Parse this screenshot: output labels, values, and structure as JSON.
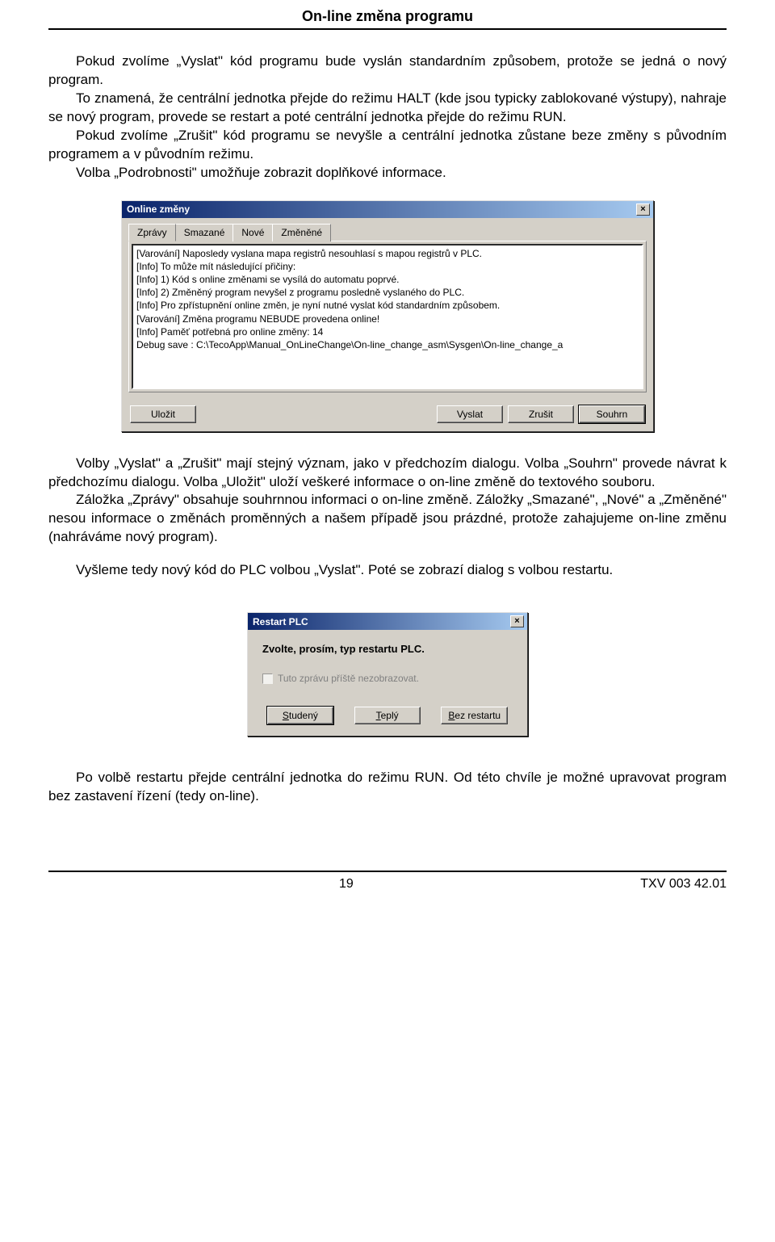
{
  "header": {
    "title": "On-line změna programu"
  },
  "para1": "Pokud zvolíme „Vyslat\" kód programu bude vyslán standardním způsobem, protože se jedná o nový program.",
  "para2": "To znamená, že centrální jednotka přejde do režimu HALT (kde jsou typicky zablokované výstupy), nahraje se nový program, provede se restart a poté centrální jednotka přejde do režimu RUN.",
  "para3": "Pokud zvolíme „Zrušit\" kód programu se nevyšle a centrální jednotka zůstane beze změny s původním programem a v původním režimu.",
  "para4": "Volba „Podrobnosti\" umožňuje zobrazit doplňkové informace.",
  "dialog1": {
    "title": "Online změny",
    "tabs": [
      "Zprávy",
      "Smazané",
      "Nové",
      "Změněné"
    ],
    "messages": [
      "[Varování] Naposledy vyslana mapa registrů nesouhlasí s mapou registrů v PLC.",
      "[Info] To může mít následující přičiny:",
      "[Info] 1) Kód s online změnami se vysílá do automatu poprvé.",
      "[Info] 2) Změněný program nevyšel z programu posledně vyslaného do PLC.",
      "[Info] Pro zpřístupnění online změn, je nyní nutné vyslat kód standardním způsobem.",
      "[Varování] Změna programu NEBUDE provedena online!",
      "[Info] Paměť potřebná pro online změny: 14",
      "Debug save : C:\\TecoApp\\Manual_OnLineChange\\On-line_change_asm\\Sysgen\\On-line_change_a"
    ],
    "buttons": {
      "save": "Uložit",
      "send": "Vyslat",
      "cancel": "Zrušit",
      "summary": "Souhrn"
    }
  },
  "para5": "Volby „Vyslat\" a „Zrušit\" mají stejný význam, jako v předchozím dialogu. Volba „Souhrn\" provede návrat k předchozímu dialogu. Volba „Uložit\" uloží veškeré informace o on-line změně do textového souboru.",
  "para6": "Záložka „Zprávy\" obsahuje souhrnnou informaci o on-line změně. Záložky „Smazané\", „Nové\" a „Změněné\" nesou informace o změnách proměnných a našem případě jsou prázdné, protože zahajujeme on-line změnu (nahráváme nový program).",
  "para7": "Vyšleme tedy nový kód do PLC volbou „Vyslat\". Poté se zobrazí dialog s volbou restartu.",
  "dialog2": {
    "title": "Restart PLC",
    "prompt": "Zvolte, prosím, typ restartu PLC.",
    "checkbox_label": "Tuto zprávu příště nezobrazovat.",
    "buttons": {
      "cold": {
        "pre": "",
        "mn": "S",
        "post": "tudený"
      },
      "warm": {
        "pre": "",
        "mn": "T",
        "post": "eplý"
      },
      "none": {
        "pre": "",
        "mn": "B",
        "post": "ez restartu"
      }
    }
  },
  "para8": "Po volbě restartu přejde centrální jednotka do režimu RUN. Od této chvíle je možné upravovat program bez zastavení řízení (tedy on-line).",
  "footer": {
    "page": "19",
    "doc": "TXV 003 42.01"
  }
}
